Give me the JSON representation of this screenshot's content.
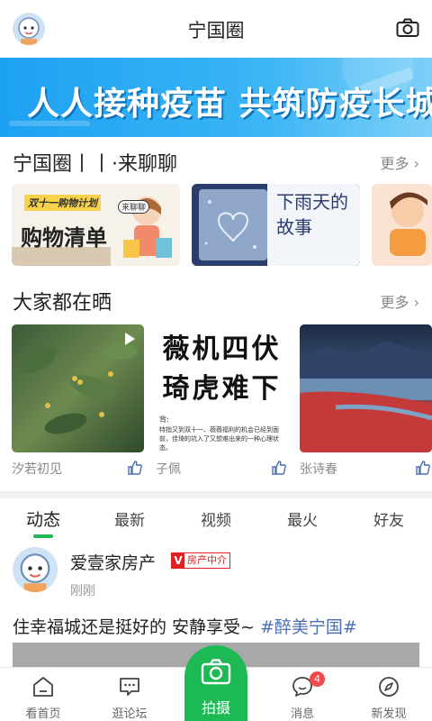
{
  "header": {
    "title": "宁国圈"
  },
  "banner": {
    "text": "人人接种疫苗 共筑防疫长城"
  },
  "section_chat": {
    "title": "宁国圈丨丨·来聊聊",
    "more": "更多",
    "cards": [
      {
        "tag": "双十一购物计划",
        "title": "购物清单",
        "corner": "来聊聊"
      },
      {
        "title": "下雨天的故事"
      },
      {
        "title": ""
      }
    ]
  },
  "section_share": {
    "title": "大家都在晒",
    "more": "更多",
    "items": [
      {
        "author": "汐若初见"
      },
      {
        "author": "子佩",
        "headline": "薇机四伏 琦虎难下",
        "caption_lead": "背:",
        "caption": "特指又到双十一、薇薇福利的机会已经到面前，佳琦的坑入了又想难出来的一种心理状态。"
      },
      {
        "author": "张诗春"
      }
    ]
  },
  "tabs": [
    {
      "label": "动态",
      "active": true
    },
    {
      "label": "最新"
    },
    {
      "label": "视频"
    },
    {
      "label": "最火"
    },
    {
      "label": "好友"
    }
  ],
  "post": {
    "author": "爱壹家房产",
    "badge_v": "V",
    "badge_text": "房产中介",
    "time": "刚刚",
    "text": "住幸福城还是挺好的 安静享受~ ",
    "tag": "#醉美宁国#"
  },
  "bottom_nav": {
    "home": "看首页",
    "forum": "逛论坛",
    "shoot": "拍摄",
    "messages": "消息",
    "messages_badge": "4",
    "discover": "新发现"
  },
  "colors": {
    "accent": "#1cb955",
    "banner": "#1da1f2",
    "badge": "#e02020",
    "tag": "#4a6fb5"
  }
}
